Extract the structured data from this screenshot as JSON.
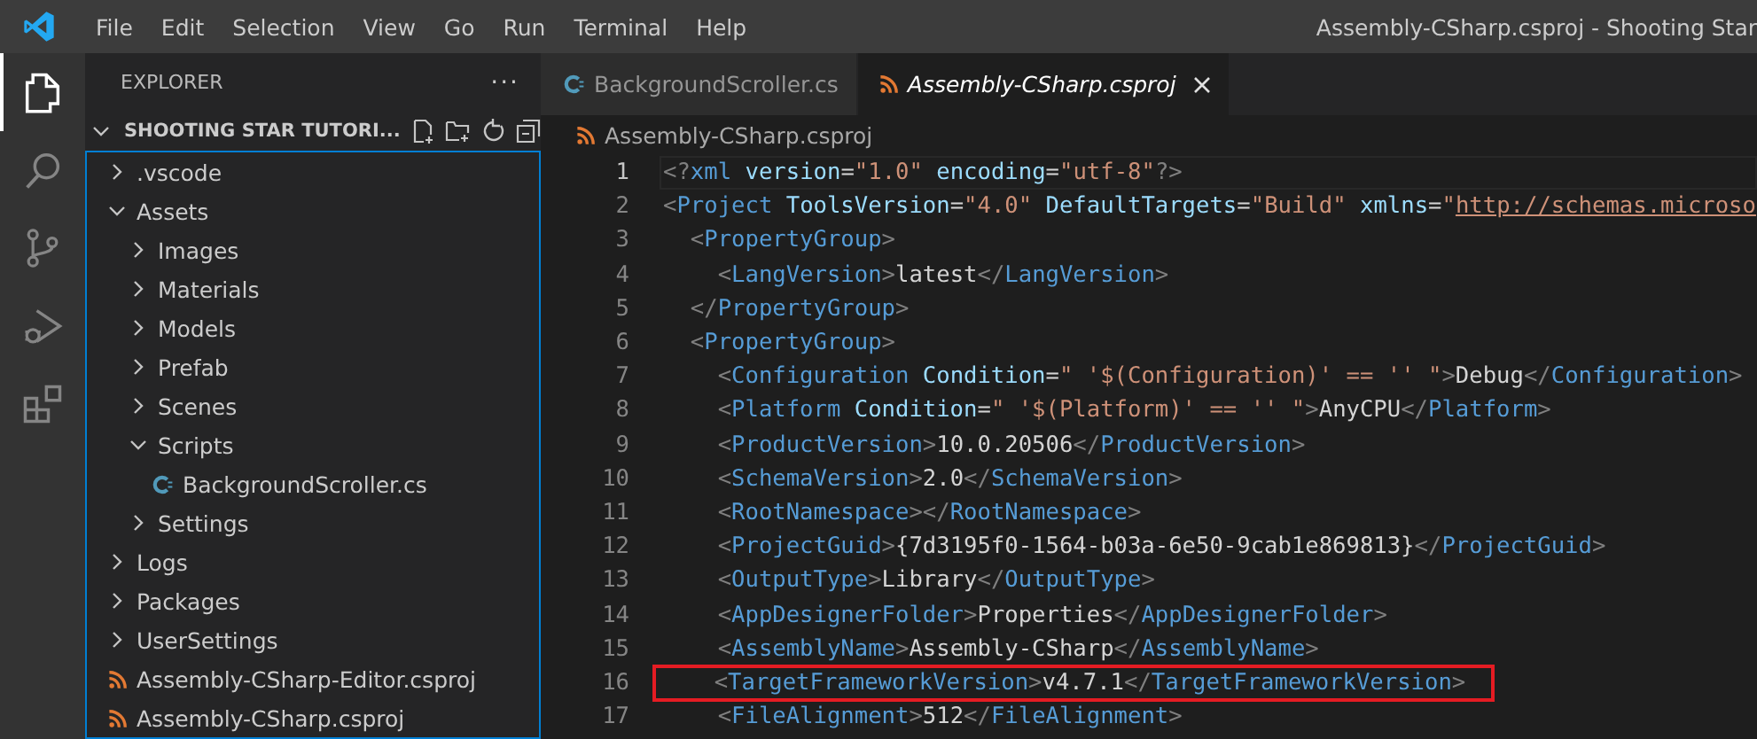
{
  "window": {
    "title": "Assembly-CSharp.csproj - Shooting Star"
  },
  "menu": [
    "File",
    "Edit",
    "Selection",
    "View",
    "Go",
    "Run",
    "Terminal",
    "Help"
  ],
  "activity_bar": [
    {
      "kind": "explorer",
      "selected": true
    },
    {
      "kind": "search",
      "selected": false
    },
    {
      "kind": "source-control",
      "selected": false
    },
    {
      "kind": "run-debug",
      "selected": false
    },
    {
      "kind": "extensions",
      "selected": false
    }
  ],
  "sidebar": {
    "title": "EXPLORER",
    "more": "···",
    "section": {
      "title": "SHOOTING STAR TUTORI...",
      "expanded": true
    },
    "items": [
      {
        "label": ".vscode",
        "kind": "folder",
        "expanded": false
      },
      {
        "label": "Assets",
        "kind": "folder",
        "expanded": true,
        "children": [
          {
            "label": "Images",
            "kind": "folder",
            "expanded": false
          },
          {
            "label": "Materials",
            "kind": "folder",
            "expanded": false
          },
          {
            "label": "Models",
            "kind": "folder",
            "expanded": false
          },
          {
            "label": "Prefab",
            "kind": "folder",
            "expanded": false
          },
          {
            "label": "Scenes",
            "kind": "folder",
            "expanded": false
          },
          {
            "label": "Scripts",
            "kind": "folder",
            "expanded": true,
            "children": [
              {
                "label": "BackgroundScroller.cs",
                "kind": "csharp"
              }
            ]
          },
          {
            "label": "Settings",
            "kind": "folder",
            "expanded": false
          }
        ]
      },
      {
        "label": "Logs",
        "kind": "folder",
        "expanded": false
      },
      {
        "label": "Packages",
        "kind": "folder",
        "expanded": false
      },
      {
        "label": "UserSettings",
        "kind": "folder",
        "expanded": false
      },
      {
        "label": "Assembly-CSharp-Editor.csproj",
        "kind": "xml"
      },
      {
        "label": "Assembly-CSharp.csproj",
        "kind": "xml"
      }
    ]
  },
  "tabs": [
    {
      "label": "BackgroundScroller.cs",
      "kind": "csharp",
      "selected": false,
      "preview": false
    },
    {
      "label": "Assembly-CSharp.csproj",
      "kind": "xml",
      "selected": true,
      "preview": true
    }
  ],
  "breadcrumb": {
    "label": "Assembly-CSharp.csproj",
    "kind": "xml"
  },
  "code_lines": [
    {
      "number": "1",
      "current": true,
      "boxed": false,
      "tokens": [
        {
          "kind": "punct",
          "text": "<?"
        },
        {
          "kind": "tag",
          "text": "xml "
        },
        {
          "kind": "attr",
          "text": "version"
        },
        {
          "kind": "text",
          "text": "="
        },
        {
          "kind": "str",
          "text": "\"1.0\" "
        },
        {
          "kind": "attr",
          "text": "encoding"
        },
        {
          "kind": "text",
          "text": "="
        },
        {
          "kind": "str",
          "text": "\"utf-8\""
        },
        {
          "kind": "punct",
          "text": "?>"
        }
      ]
    },
    {
      "number": "2",
      "current": false,
      "boxed": false,
      "tokens": [
        {
          "kind": "punct",
          "text": "<"
        },
        {
          "kind": "tag",
          "text": "Project "
        },
        {
          "kind": "attr",
          "text": "ToolsVersion"
        },
        {
          "kind": "text",
          "text": "="
        },
        {
          "kind": "str",
          "text": "\"4.0\" "
        },
        {
          "kind": "attr",
          "text": "DefaultTargets"
        },
        {
          "kind": "text",
          "text": "="
        },
        {
          "kind": "str",
          "text": "\"Build\" "
        },
        {
          "kind": "attr",
          "text": "xmlns"
        },
        {
          "kind": "text",
          "text": "="
        },
        {
          "kind": "str",
          "text": "\""
        },
        {
          "kind": "link",
          "text": "http://schemas.microso"
        }
      ]
    },
    {
      "number": "3",
      "current": false,
      "boxed": false,
      "tokens": [
        {
          "kind": "punct",
          "text": "  <"
        },
        {
          "kind": "tag",
          "text": "PropertyGroup"
        },
        {
          "kind": "punct",
          "text": ">"
        }
      ]
    },
    {
      "number": "4",
      "current": false,
      "boxed": false,
      "tokens": [
        {
          "kind": "punct",
          "text": "    <"
        },
        {
          "kind": "tag",
          "text": "LangVersion"
        },
        {
          "kind": "punct",
          "text": ">"
        },
        {
          "kind": "text",
          "text": "latest"
        },
        {
          "kind": "punct",
          "text": "</"
        },
        {
          "kind": "tag",
          "text": "LangVersion"
        },
        {
          "kind": "punct",
          "text": ">"
        }
      ]
    },
    {
      "number": "5",
      "current": false,
      "boxed": false,
      "tokens": [
        {
          "kind": "punct",
          "text": "  </"
        },
        {
          "kind": "tag",
          "text": "PropertyGroup"
        },
        {
          "kind": "punct",
          "text": ">"
        }
      ]
    },
    {
      "number": "6",
      "current": false,
      "boxed": false,
      "tokens": [
        {
          "kind": "punct",
          "text": "  <"
        },
        {
          "kind": "tag",
          "text": "PropertyGroup"
        },
        {
          "kind": "punct",
          "text": ">"
        }
      ]
    },
    {
      "number": "7",
      "current": false,
      "boxed": false,
      "tokens": [
        {
          "kind": "punct",
          "text": "    <"
        },
        {
          "kind": "tag",
          "text": "Configuration "
        },
        {
          "kind": "attr",
          "text": "Condition"
        },
        {
          "kind": "text",
          "text": "="
        },
        {
          "kind": "str",
          "text": "\" '$(Configuration)' == '' \""
        },
        {
          "kind": "punct",
          "text": ">"
        },
        {
          "kind": "text",
          "text": "Debug"
        },
        {
          "kind": "punct",
          "text": "</"
        },
        {
          "kind": "tag",
          "text": "Configuration"
        },
        {
          "kind": "punct",
          "text": ">"
        }
      ]
    },
    {
      "number": "8",
      "current": false,
      "boxed": false,
      "tokens": [
        {
          "kind": "punct",
          "text": "    <"
        },
        {
          "kind": "tag",
          "text": "Platform "
        },
        {
          "kind": "attr",
          "text": "Condition"
        },
        {
          "kind": "text",
          "text": "="
        },
        {
          "kind": "str",
          "text": "\" '$(Platform)' == '' \""
        },
        {
          "kind": "punct",
          "text": ">"
        },
        {
          "kind": "text",
          "text": "AnyCPU"
        },
        {
          "kind": "punct",
          "text": "</"
        },
        {
          "kind": "tag",
          "text": "Platform"
        },
        {
          "kind": "punct",
          "text": ">"
        }
      ]
    },
    {
      "number": "9",
      "current": false,
      "boxed": false,
      "tokens": [
        {
          "kind": "punct",
          "text": "    <"
        },
        {
          "kind": "tag",
          "text": "ProductVersion"
        },
        {
          "kind": "punct",
          "text": ">"
        },
        {
          "kind": "text",
          "text": "10.0.20506"
        },
        {
          "kind": "punct",
          "text": "</"
        },
        {
          "kind": "tag",
          "text": "ProductVersion"
        },
        {
          "kind": "punct",
          "text": ">"
        }
      ]
    },
    {
      "number": "10",
      "current": false,
      "boxed": false,
      "tokens": [
        {
          "kind": "punct",
          "text": "    <"
        },
        {
          "kind": "tag",
          "text": "SchemaVersion"
        },
        {
          "kind": "punct",
          "text": ">"
        },
        {
          "kind": "text",
          "text": "2.0"
        },
        {
          "kind": "punct",
          "text": "</"
        },
        {
          "kind": "tag",
          "text": "SchemaVersion"
        },
        {
          "kind": "punct",
          "text": ">"
        }
      ]
    },
    {
      "number": "11",
      "current": false,
      "boxed": false,
      "tokens": [
        {
          "kind": "punct",
          "text": "    <"
        },
        {
          "kind": "tag",
          "text": "RootNamespace"
        },
        {
          "kind": "punct",
          "text": "></"
        },
        {
          "kind": "tag",
          "text": "RootNamespace"
        },
        {
          "kind": "punct",
          "text": ">"
        }
      ]
    },
    {
      "number": "12",
      "current": false,
      "boxed": false,
      "tokens": [
        {
          "kind": "punct",
          "text": "    <"
        },
        {
          "kind": "tag",
          "text": "ProjectGuid"
        },
        {
          "kind": "punct",
          "text": ">"
        },
        {
          "kind": "text",
          "text": "{7d3195f0-1564-b03a-6e50-9cab1e869813}"
        },
        {
          "kind": "punct",
          "text": "</"
        },
        {
          "kind": "tag",
          "text": "ProjectGuid"
        },
        {
          "kind": "punct",
          "text": ">"
        }
      ]
    },
    {
      "number": "13",
      "current": false,
      "boxed": false,
      "tokens": [
        {
          "kind": "punct",
          "text": "    <"
        },
        {
          "kind": "tag",
          "text": "OutputType"
        },
        {
          "kind": "punct",
          "text": ">"
        },
        {
          "kind": "text",
          "text": "Library"
        },
        {
          "kind": "punct",
          "text": "</"
        },
        {
          "kind": "tag",
          "text": "OutputType"
        },
        {
          "kind": "punct",
          "text": ">"
        }
      ]
    },
    {
      "number": "14",
      "current": false,
      "boxed": false,
      "tokens": [
        {
          "kind": "punct",
          "text": "    <"
        },
        {
          "kind": "tag",
          "text": "AppDesignerFolder"
        },
        {
          "kind": "punct",
          "text": ">"
        },
        {
          "kind": "text",
          "text": "Properties"
        },
        {
          "kind": "punct",
          "text": "</"
        },
        {
          "kind": "tag",
          "text": "AppDesignerFolder"
        },
        {
          "kind": "punct",
          "text": ">"
        }
      ]
    },
    {
      "number": "15",
      "current": false,
      "boxed": false,
      "tokens": [
        {
          "kind": "punct",
          "text": "    <"
        },
        {
          "kind": "tag",
          "text": "AssemblyName"
        },
        {
          "kind": "punct",
          "text": ">"
        },
        {
          "kind": "text",
          "text": "Assembly-CSharp"
        },
        {
          "kind": "punct",
          "text": "</"
        },
        {
          "kind": "tag",
          "text": "AssemblyName"
        },
        {
          "kind": "punct",
          "text": ">"
        }
      ]
    },
    {
      "number": "16",
      "current": false,
      "boxed": true,
      "tokens": [
        {
          "kind": "punct",
          "text": "    <"
        },
        {
          "kind": "tag",
          "text": "TargetFrameworkVersion"
        },
        {
          "kind": "punct",
          "text": ">"
        },
        {
          "kind": "text",
          "text": "v4.7.1"
        },
        {
          "kind": "punct",
          "text": "</"
        },
        {
          "kind": "tag",
          "text": "TargetFrameworkVersion"
        },
        {
          "kind": "punct",
          "text": ">"
        }
      ]
    },
    {
      "number": "17",
      "current": false,
      "boxed": false,
      "tokens": [
        {
          "kind": "punct",
          "text": "    <"
        },
        {
          "kind": "tag",
          "text": "FileAlignment"
        },
        {
          "kind": "punct",
          "text": ">"
        },
        {
          "kind": "text",
          "text": "512"
        },
        {
          "kind": "punct",
          "text": "</"
        },
        {
          "kind": "tag",
          "text": "FileAlignment"
        },
        {
          "kind": "punct",
          "text": ">"
        }
      ]
    }
  ]
}
